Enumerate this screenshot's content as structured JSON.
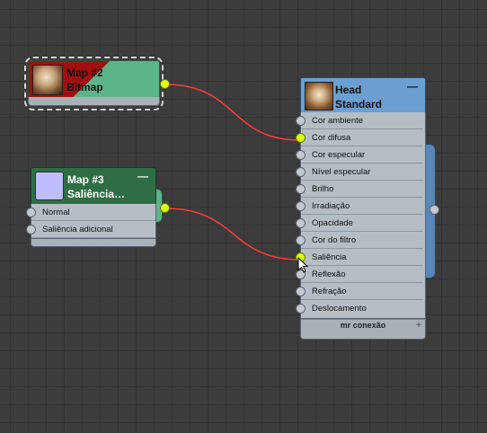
{
  "nodes": {
    "map2": {
      "title": "Map #2",
      "subtitle": "Bitmap"
    },
    "map3": {
      "title": "Map #3",
      "subtitle": "Saliência…",
      "minimize": "—",
      "slots": [
        {
          "label": "Normal"
        },
        {
          "label": "Saliência adicional"
        }
      ]
    },
    "head": {
      "title": "Head",
      "subtitle": "Standard",
      "minimize": "—",
      "slots": [
        {
          "label": "Cor ambiente",
          "connected": false
        },
        {
          "label": "Cor difusa",
          "connected": true
        },
        {
          "label": "Cor especular",
          "connected": false
        },
        {
          "label": "Nível especular",
          "connected": false
        },
        {
          "label": "Brilho",
          "connected": false
        },
        {
          "label": "Irradiação",
          "connected": false
        },
        {
          "label": "Opacidade",
          "connected": false
        },
        {
          "label": "Cor do filtro",
          "connected": false
        },
        {
          "label": "Saliência",
          "connected": true
        },
        {
          "label": "Reflexão",
          "connected": false
        },
        {
          "label": "Refração",
          "connected": false
        },
        {
          "label": "Deslocamento",
          "connected": false
        }
      ],
      "footer": "mr conexão",
      "footer_plus": "+"
    }
  },
  "colors": {
    "wire": "#ff3a3a",
    "port_active": "#d8ff18",
    "map_header": "#5bb589",
    "material_header": "#6b9fd2"
  }
}
